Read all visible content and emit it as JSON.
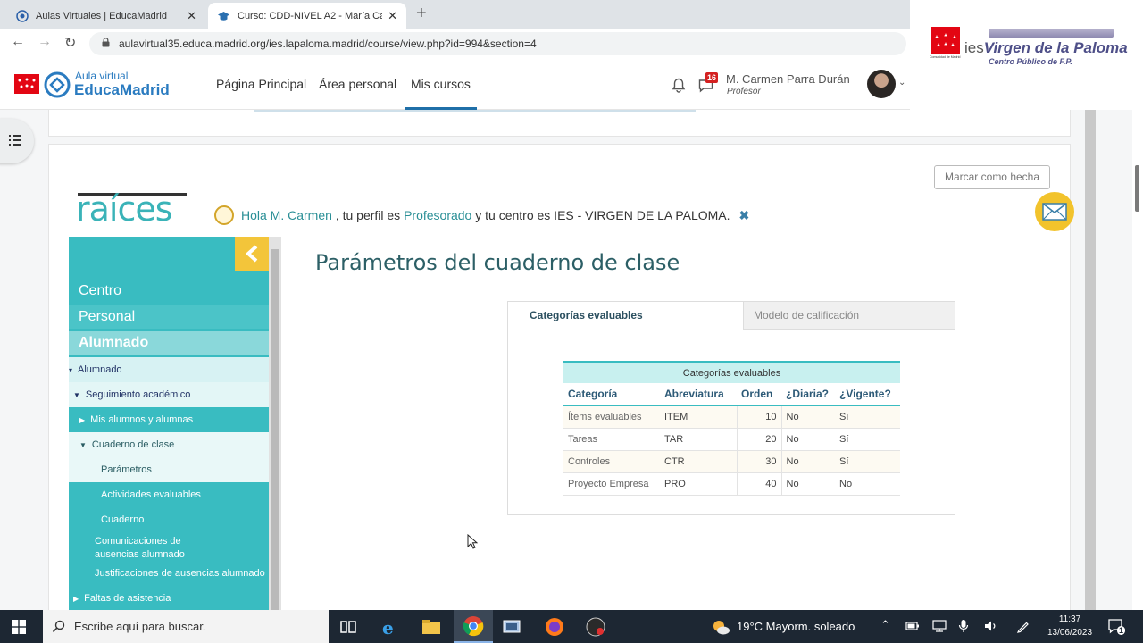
{
  "browser": {
    "tabs": [
      {
        "title": "Aulas Virtuales | EducaMadrid",
        "active": false
      },
      {
        "title": "Curso: CDD-NIVEL A2 - María Ca",
        "active": true
      }
    ],
    "url": "aulavirtual35.educa.madrid.org/ies.lapaloma.madrid/course/view.php?id=994&section=4"
  },
  "corner": {
    "community_label": "Comunidad de Madrid",
    "school_prefix": "ies",
    "school_name": "Virgen de la Paloma",
    "school_sub": "Centro Público de F.P."
  },
  "moodle": {
    "brand_top": "Aula virtual",
    "brand_main": "EducaMadrid",
    "nav": [
      "Página Principal",
      "Área personal",
      "Mis cursos"
    ],
    "active_nav_index": 2,
    "messages_count": "16",
    "user_name": "M. Carmen Parra Durán",
    "user_role": "Profesor"
  },
  "card": {
    "mark_done": "Marcar como hecha"
  },
  "raices": {
    "logo": "raíces",
    "greeting_hello": "Hola M. Carmen",
    "greeting_mid": " , tu perfil es ",
    "greeting_profile": "Profesorado",
    "greeting_tail": " y tu centro es IES - VIRGEN DE LA PALOMA.",
    "sidebar": {
      "top": [
        "Centro",
        "Personal",
        "Alumnado"
      ],
      "alumnado": "Alumnado",
      "seguimiento": "Seguimiento académico",
      "mis_alumnos": "Mis alumnos y alumnas",
      "cuaderno_clase": "Cuaderno de clase",
      "parametros": "Parámetros",
      "actividades": "Actividades evaluables",
      "cuaderno": "Cuaderno",
      "comunicaciones": "Comunicaciones de ausencias alumnado",
      "justificaciones": "Justificaciones de ausencias alumnado",
      "faltas": "Faltas de asistencia"
    },
    "page_title": "Parámetros del cuaderno de clase",
    "tabs": [
      "Categorías evaluables",
      "Modelo de calificación"
    ],
    "table": {
      "caption": "Categorías evaluables",
      "headers": [
        "Categoría",
        "Abreviatura",
        "Orden",
        "¿Diaria?",
        "¿Vigente?"
      ],
      "rows": [
        [
          "Ítems evaluables",
          "ITEM",
          "10",
          "No",
          "Sí"
        ],
        [
          "Tareas",
          "TAR",
          "20",
          "No",
          "Sí"
        ],
        [
          "Controles",
          "CTR",
          "30",
          "No",
          "Sí"
        ],
        [
          "Proyecto Empresa",
          "PRO",
          "40",
          "No",
          "No"
        ]
      ]
    }
  },
  "taskbar": {
    "search_placeholder": "Escribe aquí para buscar.",
    "weather": "19°C  Mayorm. soleado",
    "time": "11:37",
    "date": "13/06/2023",
    "notifications": "1"
  },
  "colors": {
    "raices_teal": "#39bcc1",
    "accent_yellow": "#f3c53a",
    "moodle_blue": "#1f6fa8",
    "madrid_red": "#e30613"
  }
}
